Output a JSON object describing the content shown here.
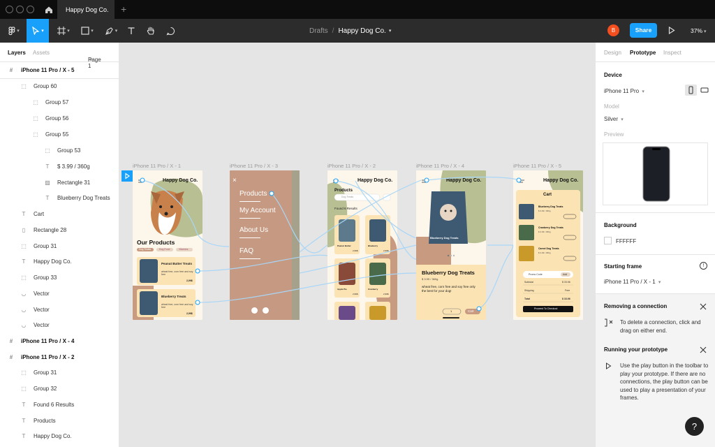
{
  "titlebar": {
    "file_tab": "Happy Dog Co.",
    "new_tab_icon": "plus-icon"
  },
  "toolbar": {
    "breadcrumb_drafts": "Drafts",
    "breadcrumb_sep": "/",
    "breadcrumb_file": "Happy Dog Co.",
    "avatar_initial": "B",
    "share_label": "Share",
    "zoom": "37%",
    "colors": {
      "accent": "#18a0fb",
      "avatar": "#f24e1e"
    }
  },
  "left_panel": {
    "tabs": {
      "layers": "Layers",
      "assets": "Assets",
      "page": "Page 1"
    },
    "layers": [
      {
        "label": "iPhone 11 Pro / X - 5",
        "type": "frame"
      },
      {
        "label": "Group 60",
        "type": "group"
      },
      {
        "label": "Group 57",
        "type": "group"
      },
      {
        "label": "Group 56",
        "type": "group"
      },
      {
        "label": "Group 55",
        "type": "group"
      },
      {
        "label": "Group 53",
        "type": "group"
      },
      {
        "label": "$ 3.99 / 360g",
        "type": "text"
      },
      {
        "label": "Rectangle 31",
        "type": "image"
      },
      {
        "label": "Blueberry Dog Treats",
        "type": "text"
      },
      {
        "label": "Cart",
        "type": "text"
      },
      {
        "label": "Rectangle 28",
        "type": "rect"
      },
      {
        "label": "Group 31",
        "type": "group"
      },
      {
        "label": "Happy Dog Co.",
        "type": "text"
      },
      {
        "label": "Group 33",
        "type": "group"
      },
      {
        "label": "Vector",
        "type": "vector"
      },
      {
        "label": "Vector",
        "type": "vector"
      },
      {
        "label": "Vector",
        "type": "vector"
      },
      {
        "label": "iPhone 11 Pro / X - 4",
        "type": "frame"
      },
      {
        "label": "iPhone 11 Pro / X - 2",
        "type": "frame"
      },
      {
        "label": "Group 31",
        "type": "group"
      },
      {
        "label": "Group 32",
        "type": "group"
      },
      {
        "label": "Found 6 Results",
        "type": "text"
      },
      {
        "label": "Products",
        "type": "text"
      },
      {
        "label": "Happy Dog Co.",
        "type": "text"
      }
    ]
  },
  "canvas": {
    "frames": [
      {
        "label": "iPhone 11 Pro / X - 1"
      },
      {
        "label": "iPhone 11 Pro / X - 3"
      },
      {
        "label": "iPhone 11 Pro / X - 2"
      },
      {
        "label": "iPhone 11 Pro / X - 4"
      },
      {
        "label": "iPhone 11 Pro / X - 5"
      }
    ],
    "brand": "Happy Dog Co.",
    "f1": {
      "heading": "Our Products",
      "chips": [
        "Dog Treats",
        "Dog Food",
        "Vitamins"
      ],
      "cards": [
        {
          "title": "Peanut Butter Treats",
          "sub": "wheat free, corn free and soy free",
          "price": "2,99$"
        },
        {
          "title": "Blueberry Treats",
          "sub": "wheat free, corn free and soy free",
          "price": "2,99$"
        }
      ]
    },
    "f3": {
      "menu": [
        "Products",
        "My Account",
        "About Us",
        "FAQ"
      ]
    },
    "f2": {
      "heading": "Products",
      "search": "Dog Treats",
      "results": "Found 6 Results",
      "items": [
        {
          "name": "Peanut Butter",
          "price": "2,99$"
        },
        {
          "name": "Blueberry",
          "price": "2,99$"
        },
        {
          "name": "Apple Pie",
          "price": "2,99$"
        },
        {
          "name": "Cranberry",
          "price": "2,99$"
        }
      ]
    },
    "f4": {
      "product": "Blueberry Dog Treats",
      "price": "$ 3.99 / 360g",
      "desc": "wheat free, corn free and soy free only the best for your dog!",
      "qty": "1",
      "cart_btn": "Cart"
    },
    "f5": {
      "title": "Cart",
      "items": [
        {
          "name": "Blueberry Dog Treats",
          "price": "$ 3.99 / 360g"
        },
        {
          "name": "Cranberry Dog Treats",
          "price": "$ 3.99 / 360g"
        },
        {
          "name": "Carrot Dog Treats",
          "price": "$ 3.99 / 360g"
        }
      ],
      "promo": "Promo Code",
      "promo_add": "Add",
      "subtotal_label": "Subtotal",
      "subtotal": "$ 33.96",
      "shipping_label": "Shipping",
      "shipping": "Free",
      "total_label": "Total",
      "total": "$ 33.96",
      "checkout": "Proceed To Checkout"
    }
  },
  "right_panel": {
    "tabs": {
      "design": "Design",
      "prototype": "Prototype",
      "inspect": "Inspect"
    },
    "device_title": "Device",
    "device_value": "iPhone 11 Pro",
    "model_label": "Model",
    "model_value": "Silver",
    "preview_label": "Preview",
    "background_title": "Background",
    "background_value": "FFFFFF",
    "starting_frame_title": "Starting frame",
    "starting_frame_value": "iPhone 11 Pro / X - 1",
    "removing_title": "Removing a connection",
    "removing_text": "To delete a connection, click and drag on either end.",
    "running_title": "Running your prototype",
    "running_text": "Use the play button in the toolbar to play your prototype. If there are no connections, the play button can be used to play a presentation of your frames.",
    "help": "?"
  }
}
